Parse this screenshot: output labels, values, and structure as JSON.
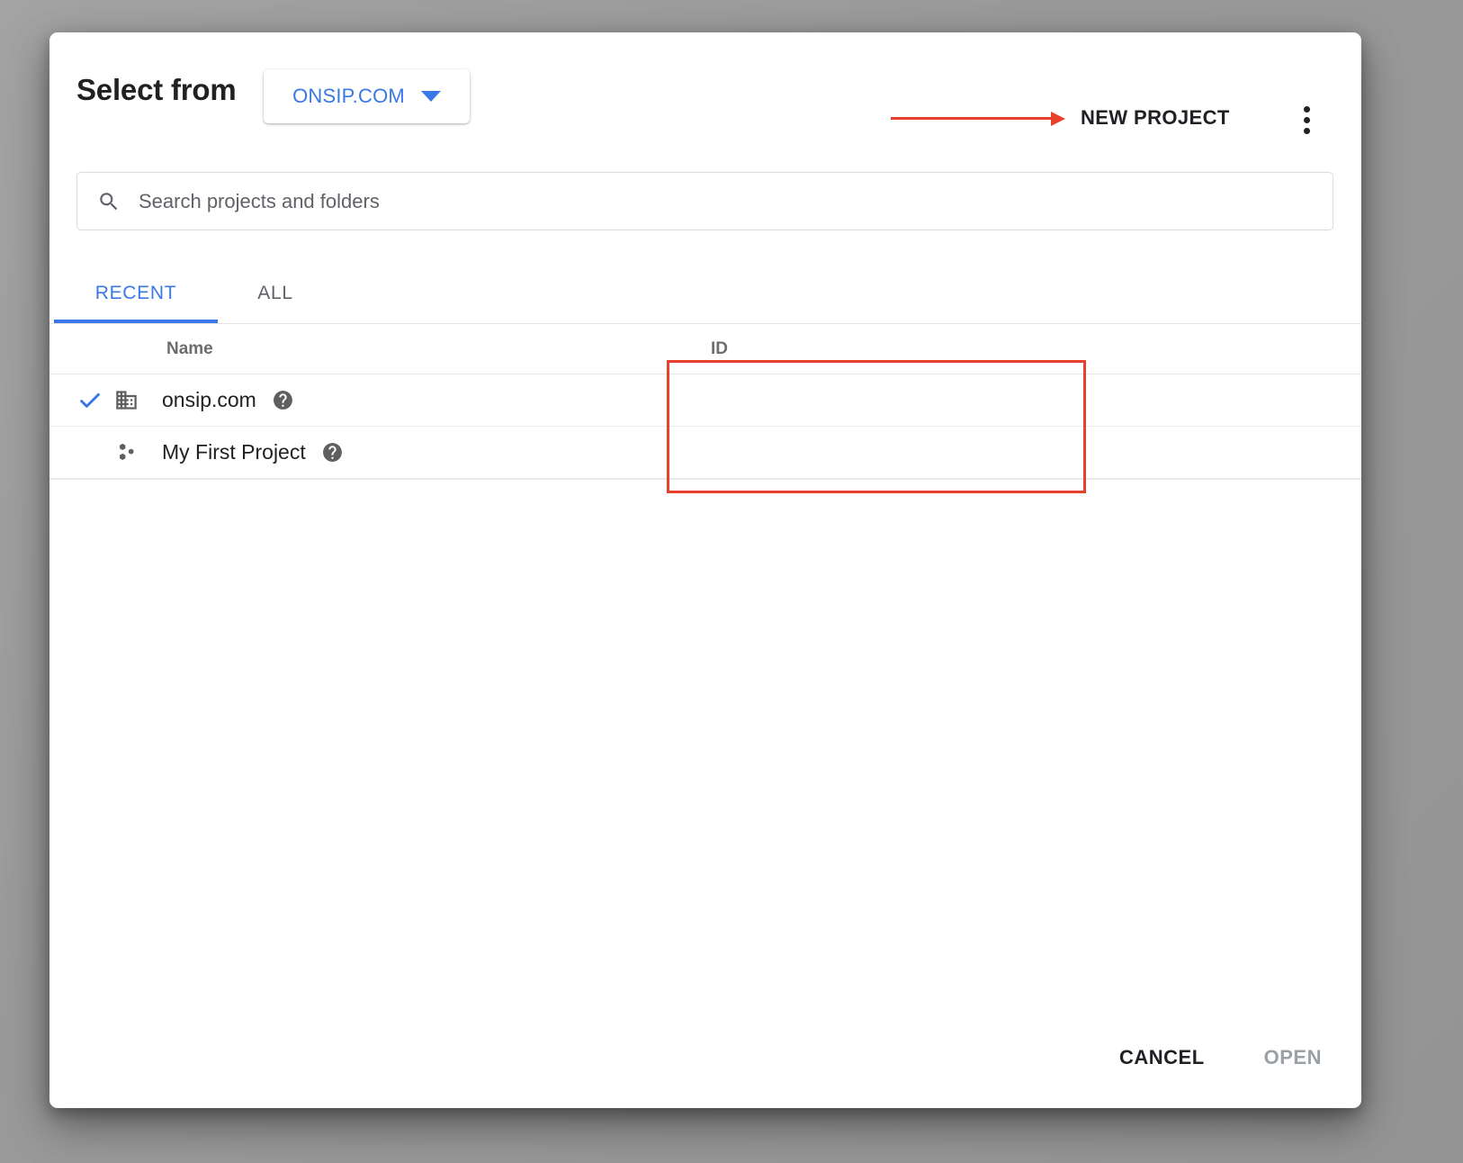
{
  "colors": {
    "accent_blue": "#3b78e7",
    "annotation_red": "#e8402a",
    "text_primary": "#202124",
    "text_secondary": "#5f6368",
    "backdrop": "#9c9c9c"
  },
  "header": {
    "title": "Select from",
    "org_chip_label": "ONSIP.COM",
    "org_chip_icon": "chevron-down-icon",
    "new_project_label": "NEW PROJECT",
    "overflow_icon": "kebab-menu-icon",
    "annotation_arrow": "red-arrow-pointing-to-new-project"
  },
  "search": {
    "icon": "search-icon",
    "placeholder": "Search projects and folders",
    "value": ""
  },
  "tabs": [
    {
      "label": "RECENT",
      "active": true
    },
    {
      "label": "ALL",
      "active": false
    }
  ],
  "table": {
    "columns": [
      {
        "key": "name",
        "label": "Name"
      },
      {
        "key": "id",
        "label": "ID"
      }
    ],
    "rows": [
      {
        "selected": true,
        "check_icon": "checkmark-icon",
        "type_icon": "organization-icon",
        "name": "onsip.com",
        "help_icon": "help-circle-icon",
        "id": ""
      },
      {
        "selected": false,
        "check_icon": "",
        "type_icon": "project-icon",
        "name": "My First Project",
        "help_icon": "help-circle-icon",
        "id": ""
      }
    ],
    "annotation": "red-rectangle-highlighting-empty-id-column"
  },
  "footer": {
    "cancel_label": "CANCEL",
    "open_label": "OPEN",
    "open_disabled": true
  }
}
